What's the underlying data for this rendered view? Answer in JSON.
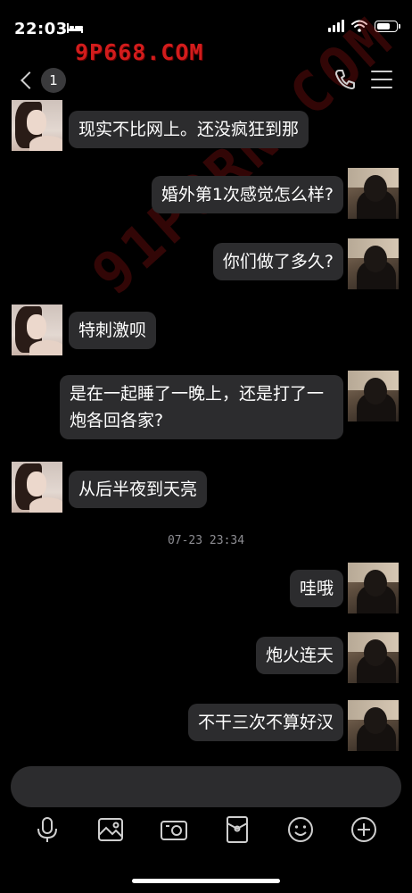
{
  "status_bar": {
    "time": "22:03",
    "battery_level": 0.7
  },
  "watermark": {
    "header": "9P668.COM",
    "diagonal": "91PORN.COM"
  },
  "nav": {
    "unread_count": "1"
  },
  "messages": [
    {
      "side": "left",
      "text": "现实不比网上。还没疯狂到那"
    },
    {
      "side": "right",
      "text": "婚外第1次感觉怎么样?"
    },
    {
      "side": "right",
      "text": "你们做了多久?"
    },
    {
      "side": "left",
      "text": "特刺激呗"
    },
    {
      "side": "right",
      "text": "是在一起睡了一晚上，还是打了一炮各回各家?"
    },
    {
      "side": "left",
      "text": "从后半夜到天亮"
    },
    {
      "side": "right",
      "text": "哇哦"
    },
    {
      "side": "right",
      "text": "炮火连天"
    },
    {
      "side": "right",
      "text": "不干三次不算好汉"
    }
  ],
  "timestamp": "07-23 23:34",
  "colors": {
    "background": "#000000",
    "bubble": "#2c2c2e",
    "icon": "#cfcfcf",
    "watermark": "#d21c1c"
  },
  "toolbar_icons": [
    "microphone-icon",
    "image-icon",
    "camera-icon",
    "red-packet-icon",
    "emoji-icon",
    "plus-icon"
  ]
}
